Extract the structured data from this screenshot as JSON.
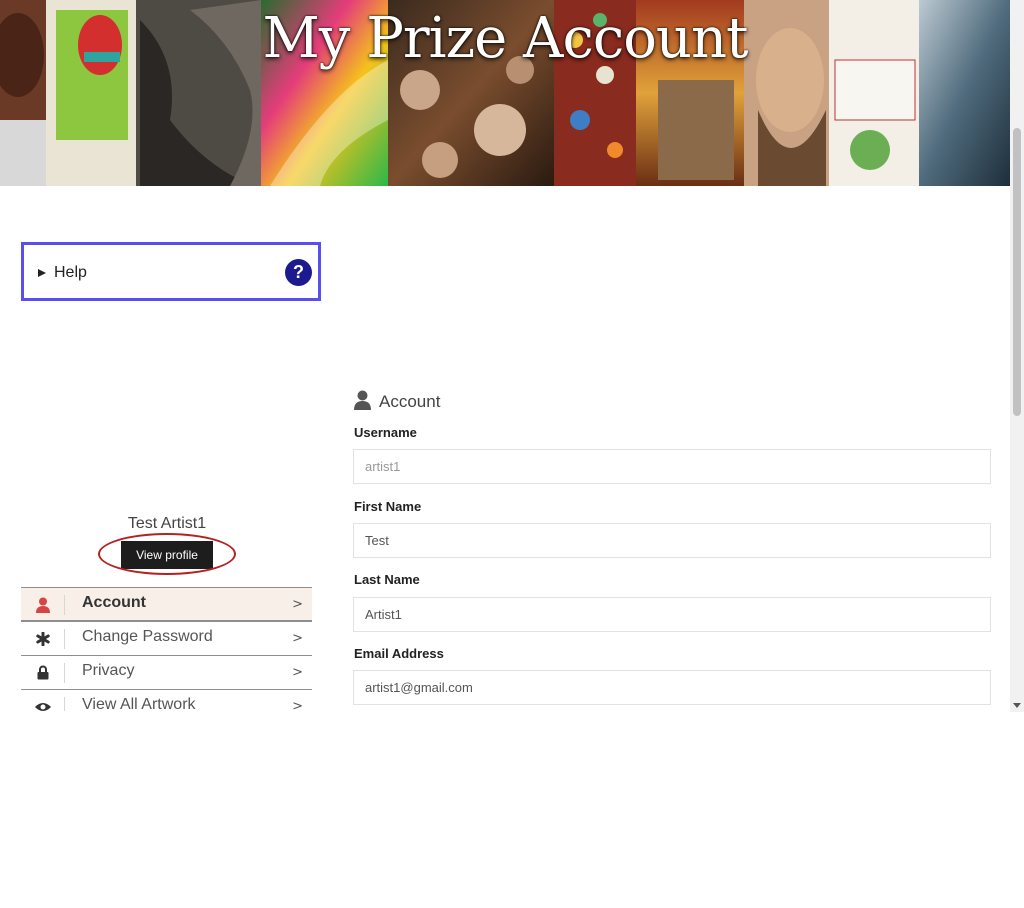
{
  "banner": {
    "title": "My Prize Account"
  },
  "help": {
    "label": "Help",
    "icon_glyph": "?",
    "icon": "question-circle-icon"
  },
  "profile": {
    "name": "Test Artist1",
    "view_button": "View profile"
  },
  "side_menu": {
    "items": [
      {
        "label": "Account",
        "icon": "user-icon",
        "active": true
      },
      {
        "label": "Change Password",
        "icon": "asterisk-icon",
        "active": false
      },
      {
        "label": "Privacy",
        "icon": "lock-icon",
        "active": false
      },
      {
        "label": "View All Artwork",
        "icon": "eye-icon",
        "active": false
      }
    ],
    "chevron": ">"
  },
  "account": {
    "title": "Account",
    "icon": "user-icon",
    "fields": [
      {
        "label": "Username",
        "value": "artist1",
        "readonly": true
      },
      {
        "label": "First Name",
        "value": "Test",
        "readonly": false
      },
      {
        "label": "Last Name",
        "value": "Artist1",
        "readonly": false
      },
      {
        "label": "Email Address",
        "value": "artist1@gmail.com",
        "readonly": false
      }
    ]
  },
  "colors": {
    "help_border": "#5b4ef0",
    "help_icon_bg": "#1d1a8f",
    "active_menu_bg": "#f7efe8",
    "active_icon": "#d64545",
    "highlight_oval": "#b32121",
    "button_bg": "#1d1d1d"
  }
}
